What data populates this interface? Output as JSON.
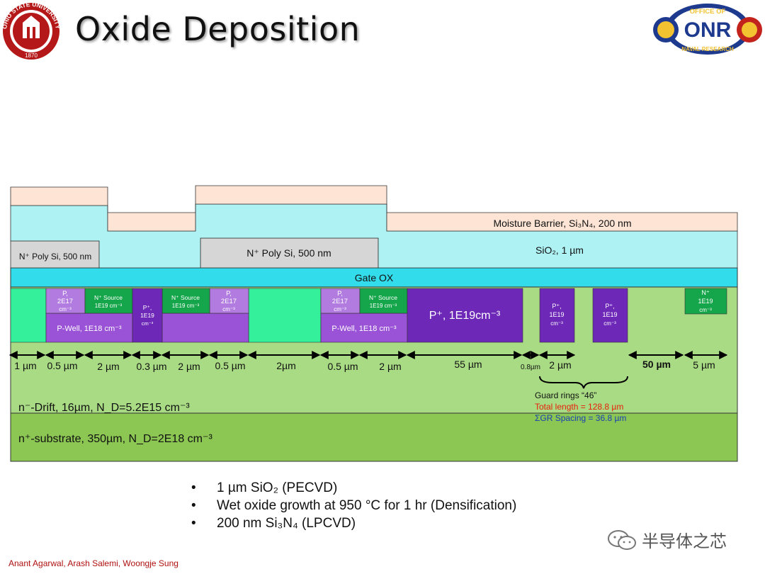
{
  "title": "Oxide Deposition",
  "logos": {
    "left_ring_text": "OHIO STATE UNIVERSITY",
    "left_year": "1870",
    "right_top": "OFFICE OF",
    "right_mid": "ONR",
    "right_bottom": "NAVAL RESEARCH"
  },
  "layers": {
    "moisture_barrier": "Moisture Barrier, Si₃N₄, 200 nm",
    "sio2": "SiO₂, 1 µm",
    "poly_left": "N⁺ Poly Si, 500 nm",
    "poly_center": "N⁺ Poly Si, 500 nm",
    "gate_ox": "Gate OX",
    "drift": "n⁻-Drift, 16µm, N_D=5.2E15 cm⁻³",
    "substrate": "n⁺-substrate, 350µm, N_D=2E18 cm⁻³"
  },
  "regions": {
    "p_2e17": [
      "P,",
      "2E17",
      "cm⁻³"
    ],
    "n_source": [
      "N⁺ Source",
      "1E19 cm⁻³"
    ],
    "p_plus_small": [
      "P⁺,",
      "1E19",
      "cm⁻³"
    ],
    "p_well": "P-Well, 1E18 cm⁻³",
    "p_plus_big": "P⁺, 1E19cm⁻³",
    "n_plus_right": [
      "N⁺",
      "1E19",
      "cm⁻³"
    ]
  },
  "dimensions": [
    "1 µm",
    "0.5 µm",
    "2 µm",
    "0.3 µm",
    "2 µm",
    "0.5 µm",
    "2µm",
    "0.5 µm",
    "2 µm",
    "55 µm",
    "0.8µm",
    "2 µm",
    "50 µm",
    "5 µm"
  ],
  "guard_rings": {
    "label": "Guard rings “46”",
    "total_length": "Total length   = 128.8 µm",
    "spacing": "ΣGR Spacing  = 36.8 µm",
    "total_color": "#e8200a",
    "spacing_color": "#1a3fb5"
  },
  "bullets": [
    "1 µm SiO₂ (PECVD)",
    "Wet oxide growth at 950 °C for 1 hr (Densification)",
    "200 nm Si₃N₄ (LPCVD)"
  ],
  "footer": "Anant Agarwal, Arash Salemi, Woongje Sung",
  "watermark": "半导体之芯",
  "colors": {
    "nitride": "#fde4d4",
    "oxide": "#aef2f4",
    "gate_ox": "#33dcea",
    "poly": "#d6d6d6",
    "drift": "#a9db84",
    "substrate": "#8bc752",
    "jfet": "#34f09a",
    "p_light": "#b27be0",
    "p_well": "#9a52d6",
    "p_plus": "#6d28b8",
    "n_source": "#15a54a"
  }
}
